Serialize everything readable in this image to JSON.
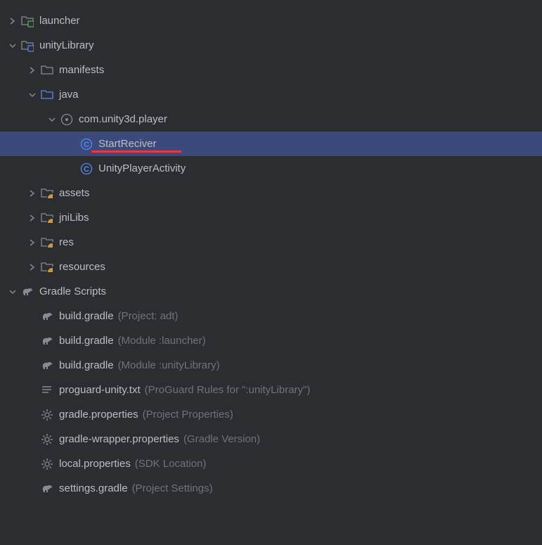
{
  "tree": {
    "launcher": "launcher",
    "unityLibrary": "unityLibrary",
    "manifests": "manifests",
    "java": "java",
    "package": "com.unity3d.player",
    "startReciver": "StartReciver",
    "unityPlayerActivity": "UnityPlayerActivity",
    "assets": "assets",
    "jniLibs": "jniLibs",
    "res": "res",
    "resources": "resources",
    "gradleScripts": "Gradle Scripts",
    "buildGradle1": "build.gradle",
    "buildGradle1Hint": "(Project: adt)",
    "buildGradle2": "build.gradle",
    "buildGradle2Hint": "(Module :launcher)",
    "buildGradle3": "build.gradle",
    "buildGradle3Hint": "(Module :unityLibrary)",
    "proguard": "proguard-unity.txt",
    "proguardHint": "(ProGuard Rules for \":unityLibrary\")",
    "gradleProps": "gradle.properties",
    "gradlePropsHint": "(Project Properties)",
    "gradleWrapper": "gradle-wrapper.properties",
    "gradleWrapperHint": "(Gradle Version)",
    "localProps": "local.properties",
    "localPropsHint": "(SDK Location)",
    "settingsGradle": "settings.gradle",
    "settingsGradleHint": "(Project Settings)"
  }
}
